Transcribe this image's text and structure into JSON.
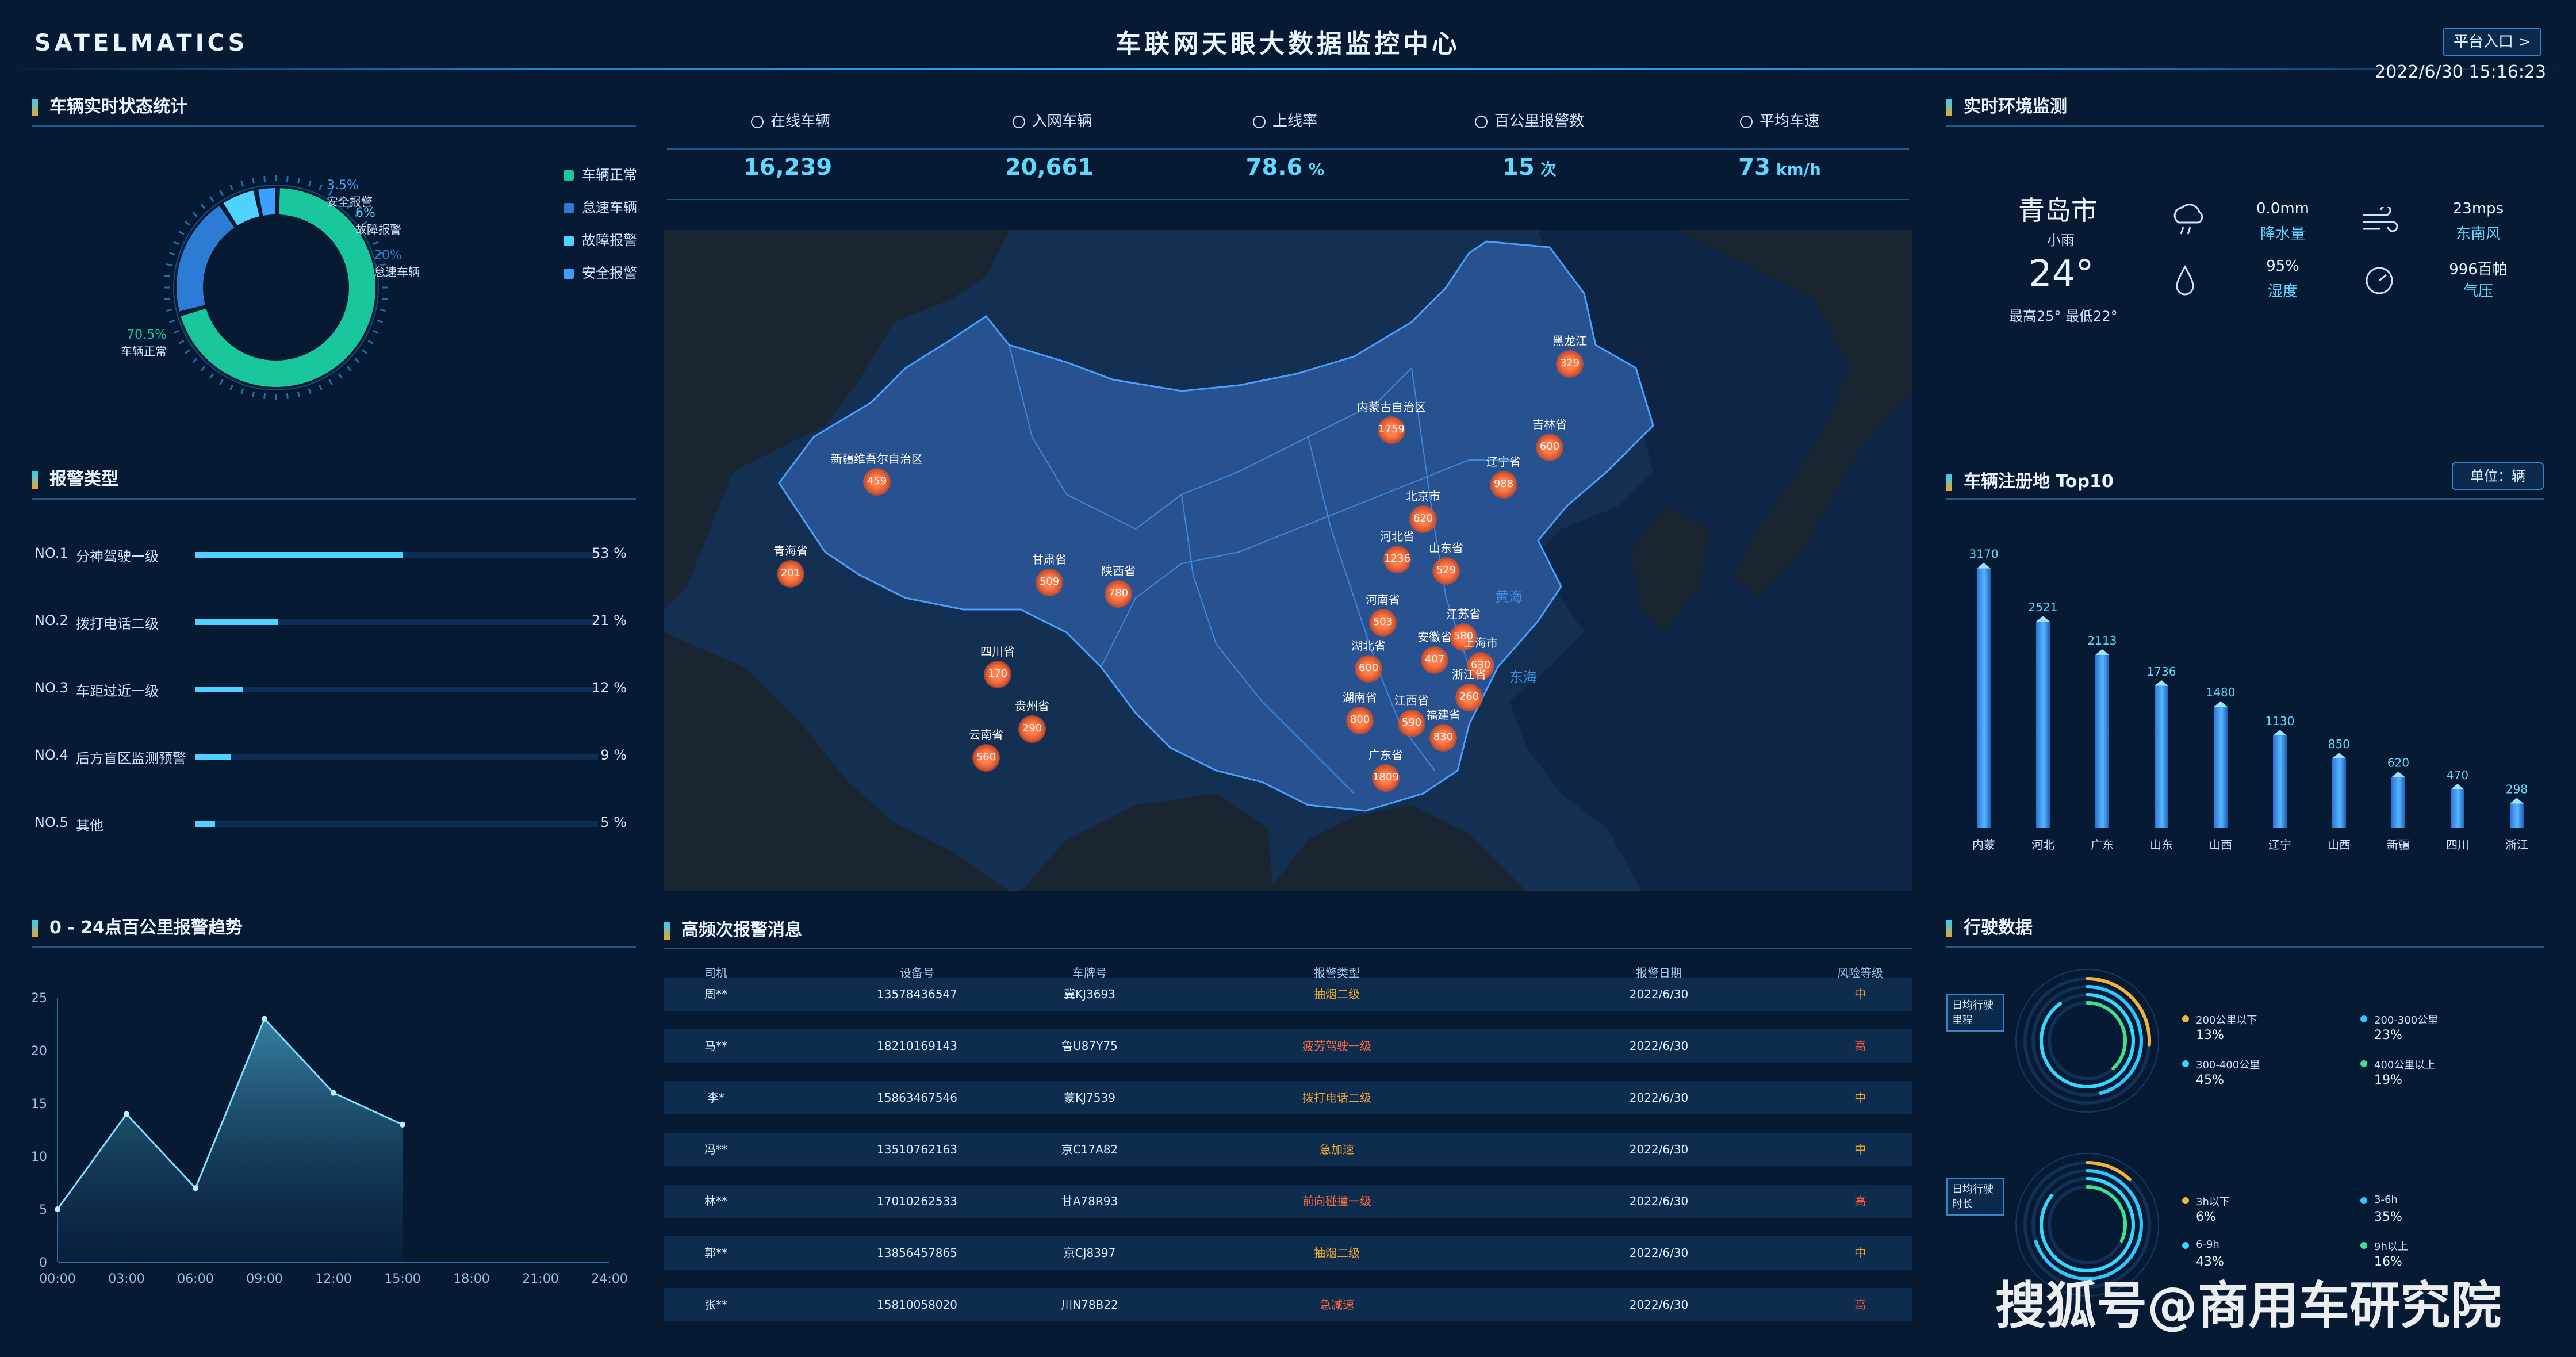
{
  "header": {
    "logo": "SATELMATICS",
    "title": "车联网天眼大数据监控中心",
    "platform_button": "平台入口 >",
    "datetime": "2022/6/30 15:16:23"
  },
  "vehicle_status": {
    "title": "车辆实时状态统计",
    "legend": [
      "车辆正常",
      "怠速车辆",
      "故障报警",
      "安全报警"
    ],
    "colors": [
      "#18c79b",
      "#2c7cd6",
      "#4fd2ff",
      "#3aa0ff"
    ],
    "segments": [
      {
        "pct_label": "70.5%",
        "name": "车辆正常",
        "value": 70.5
      },
      {
        "pct_label": "20%",
        "name": "怠速车辆",
        "value": 20
      },
      {
        "pct_label": "6%",
        "name": "故障报警",
        "value": 6
      },
      {
        "pct_label": "3.5%",
        "name": "安全报警",
        "value": 3.5
      }
    ]
  },
  "alarm_types": {
    "title": "报警类型",
    "items": [
      {
        "rank": "NO.1",
        "name": "分神驾驶一级",
        "pct_label": "53 %",
        "value": 53
      },
      {
        "rank": "NO.2",
        "name": "拨打电话二级",
        "pct_label": "21 %",
        "value": 21
      },
      {
        "rank": "NO.3",
        "name": "车距过近一级",
        "pct_label": "12 %",
        "value": 12
      },
      {
        "rank": "NO.4",
        "name": "后方盲区监测预警",
        "pct_label": "9 %",
        "value": 9
      },
      {
        "rank": "NO.5",
        "name": "其他",
        "pct_label": "5 %",
        "value": 5
      }
    ]
  },
  "trend": {
    "title": "0 - 24点百公里报警趋势",
    "chart_data": {
      "type": "area",
      "x": [
        "00:00",
        "03:00",
        "06:00",
        "09:00",
        "12:00",
        "15:00",
        "18:00",
        "21:00",
        "24:00"
      ],
      "points": [
        [
          0,
          5
        ],
        [
          3,
          14
        ],
        [
          6,
          7
        ],
        [
          9,
          23
        ],
        [
          12,
          16
        ],
        [
          15,
          13
        ]
      ],
      "yticks": [
        "0",
        "5",
        "10",
        "15",
        "20",
        "25"
      ],
      "ylim": [
        0,
        25
      ]
    }
  },
  "kpis": [
    {
      "label": "在线车辆",
      "value": "16,239",
      "unit": ""
    },
    {
      "label": "入网车辆",
      "value": "20,661",
      "unit": ""
    },
    {
      "label": "上线率",
      "value": "78.6",
      "unit": "%"
    },
    {
      "label": "百公里报警数",
      "value": "15",
      "unit": "次"
    },
    {
      "label": "平均车速",
      "value": "73",
      "unit": "km/h"
    }
  ],
  "map": {
    "sea_labels": [
      "黄海",
      "东海"
    ],
    "provinces": [
      {
        "name": "黑龙江",
        "value": "329"
      },
      {
        "name": "吉林省",
        "value": "600"
      },
      {
        "name": "辽宁省",
        "value": "988"
      },
      {
        "name": "内蒙古自治区",
        "value": "1759"
      },
      {
        "name": "北京市",
        "value": "620"
      },
      {
        "name": "河北省",
        "value": "1236"
      },
      {
        "name": "山东省",
        "value": "529"
      },
      {
        "name": "新疆维吾尔自治区",
        "value": "459"
      },
      {
        "name": "青海省",
        "value": "201"
      },
      {
        "name": "甘肃省",
        "value": "509"
      },
      {
        "name": "陕西省",
        "value": "780"
      },
      {
        "name": "河南省",
        "value": "503"
      },
      {
        "name": "江苏省",
        "value": "580"
      },
      {
        "name": "安徽省",
        "value": "407"
      },
      {
        "name": "上海市",
        "value": "630"
      },
      {
        "name": "湖北省",
        "value": "600"
      },
      {
        "name": "浙江省",
        "value": "260"
      },
      {
        "name": "四川省",
        "value": "170"
      },
      {
        "name": "湖南省",
        "value": "800"
      },
      {
        "name": "江西省",
        "value": "590"
      },
      {
        "name": "福建省",
        "value": "830"
      },
      {
        "name": "贵州省",
        "value": "290"
      },
      {
        "name": "云南省",
        "value": "560"
      },
      {
        "name": "广东省",
        "value": "1809"
      }
    ]
  },
  "alerts": {
    "title": "高频次报警消息",
    "columns": [
      "司机",
      "设备号",
      "车牌号",
      "报警类型",
      "报警日期",
      "风险等级"
    ],
    "rows": [
      {
        "driver": "周**",
        "device": "13578436547",
        "plate": "冀KJ3693",
        "type": "抽烟二级",
        "date": "2022/6/30",
        "level": "中"
      },
      {
        "driver": "马**",
        "device": "18210169143",
        "plate": "鲁U87Y75",
        "type": "疲劳驾驶一级",
        "date": "2022/6/30",
        "level": "高"
      },
      {
        "driver": "李*",
        "device": "15863467546",
        "plate": "蒙KJ7539",
        "type": "拨打电话二级",
        "date": "2022/6/30",
        "level": "中"
      },
      {
        "driver": "冯**",
        "device": "13510762163",
        "plate": "京C17A82",
        "type": "急加速",
        "date": "2022/6/30",
        "level": "中"
      },
      {
        "driver": "林**",
        "device": "17010262533",
        "plate": "甘A78R93",
        "type": "前向碰撞一级",
        "date": "2022/6/30",
        "level": "高"
      },
      {
        "driver": "郭**",
        "device": "13856457865",
        "plate": "京CJ8397",
        "type": "抽烟二级",
        "date": "2022/6/30",
        "level": "中"
      },
      {
        "driver": "张**",
        "device": "15810058020",
        "plate": "川N78B22",
        "type": "急减速",
        "date": "2022/6/30",
        "level": "高"
      }
    ]
  },
  "env": {
    "title": "实时环境监测",
    "city": "青岛市",
    "weather": "小雨",
    "temp": "24°",
    "range": "最高25° 最低22°",
    "items": [
      {
        "value": "0.0mm",
        "name": "降水量",
        "icon": "rain-icon"
      },
      {
        "value": "23mps",
        "name": "东南风",
        "icon": "wind-icon"
      },
      {
        "value": "95%",
        "name": "湿度",
        "icon": "humidity-icon"
      },
      {
        "value": "996百帕",
        "name": "气压",
        "icon": "pressure-icon"
      }
    ]
  },
  "registration": {
    "title": "车辆注册地 Top10",
    "unit_button": "单位：辆",
    "chart_data": {
      "type": "bar",
      "categories": [
        "内蒙",
        "河北",
        "广东",
        "山东",
        "山西",
        "辽宁",
        "山西",
        "新疆",
        "四川",
        "浙江"
      ],
      "values": [
        3170,
        2521,
        2113,
        1736,
        1480,
        1130,
        850,
        620,
        470,
        298
      ],
      "ylim": [
        0,
        3300
      ]
    }
  },
  "driving": {
    "title": "行驶数据",
    "mileage": {
      "label": "日均行驶里程",
      "items": [
        {
          "name": "200公里以下",
          "value": "13%",
          "color": "#f0b43a"
        },
        {
          "name": "200-300公里",
          "value": "23%",
          "color": "#2fc6ff"
        },
        {
          "name": "300-400公里",
          "value": "45%",
          "color": "#33d7ff"
        },
        {
          "name": "400公里以上",
          "value": "19%",
          "color": "#3fe08c"
        }
      ]
    },
    "duration": {
      "label": "日均行驶时长",
      "items": [
        {
          "name": "3h以下",
          "value": "6%",
          "color": "#f0b43a"
        },
        {
          "name": "3-6h",
          "value": "35%",
          "color": "#2fc6ff"
        },
        {
          "name": "6-9h",
          "value": "43%",
          "color": "#33d7ff"
        },
        {
          "name": "9h以上",
          "value": "16%",
          "color": "#3fe08c"
        }
      ]
    }
  },
  "watermark": "搜狐号@商用车研究院"
}
